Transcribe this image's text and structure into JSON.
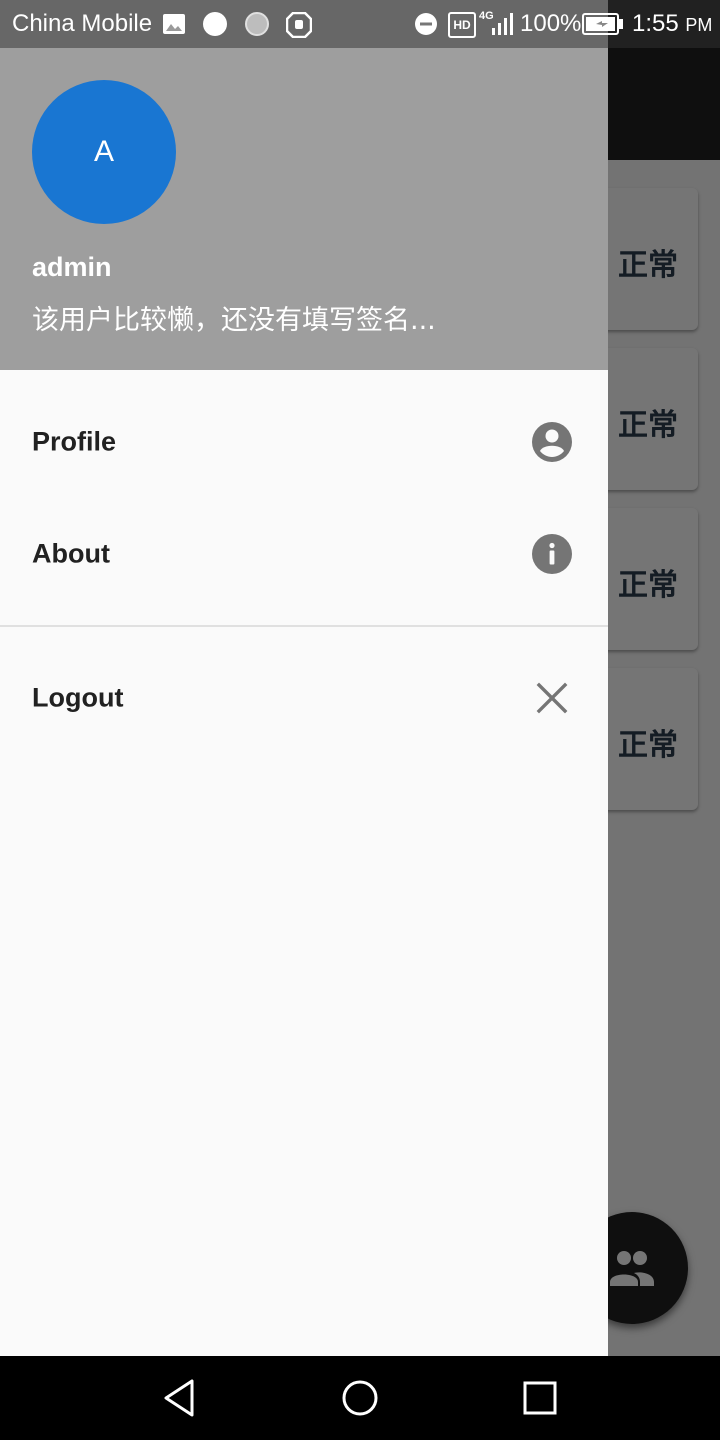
{
  "status_bar": {
    "carrier": "China Mobile",
    "network": "4G",
    "hd": "HD",
    "battery": "100%",
    "time": "1:55",
    "ampm": "PM"
  },
  "background": {
    "card_status": [
      "正常",
      "正常",
      "正常",
      "正常"
    ]
  },
  "drawer": {
    "avatar_letter": "A",
    "account_name": "admin",
    "account_signature": "该用户比较懒，还没有填写签名...",
    "menu": [
      {
        "label": "Profile",
        "icon": "account-circle-icon"
      },
      {
        "label": "About",
        "icon": "info-icon"
      },
      {
        "label": "Logout",
        "icon": "close-icon"
      }
    ]
  },
  "colors": {
    "avatar": "#1976d2",
    "header": "#9e9e9e",
    "drawer_bg": "#fafafa",
    "icon": "#757575"
  }
}
